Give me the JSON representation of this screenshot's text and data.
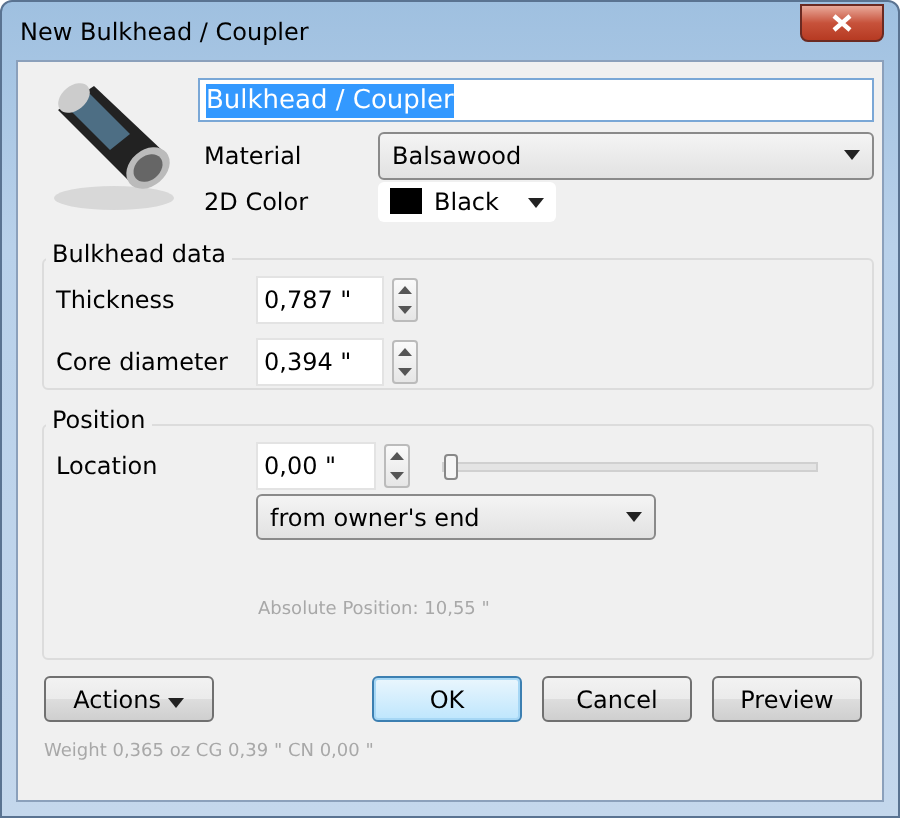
{
  "window": {
    "title": "New Bulkhead / Coupler"
  },
  "name_field": {
    "value": "Bulkhead / Coupler",
    "selected": true
  },
  "properties": [
    {
      "kind": "dropdown",
      "label": "Material",
      "value": "Balsawood"
    },
    {
      "kind": "color",
      "label": "2D Color",
      "value": "Black",
      "color": "#000000"
    }
  ],
  "bulkhead_data": {
    "title": "Bulkhead data",
    "fields": [
      {
        "label": "Thickness",
        "value": "0,787 \""
      },
      {
        "label": "Core diameter",
        "value": "0,394 \""
      }
    ]
  },
  "position": {
    "title": "Position",
    "label": "Location",
    "value": "0,00 \"",
    "slider": {
      "level": 0
    },
    "reference": "from owner's end",
    "absolute": "Absolute Position: 10,55 \""
  },
  "buttons": [
    {
      "label": "Actions",
      "kind": "menu",
      "default": false
    },
    {
      "label": "OK",
      "kind": "plain",
      "default": true
    },
    {
      "label": "Cancel",
      "kind": "plain",
      "default": false
    },
    {
      "label": "Preview",
      "kind": "plain",
      "default": false
    }
  ],
  "status_bar": "Weight 0,365 oz CG 0,39 \" CN 0,00 \""
}
